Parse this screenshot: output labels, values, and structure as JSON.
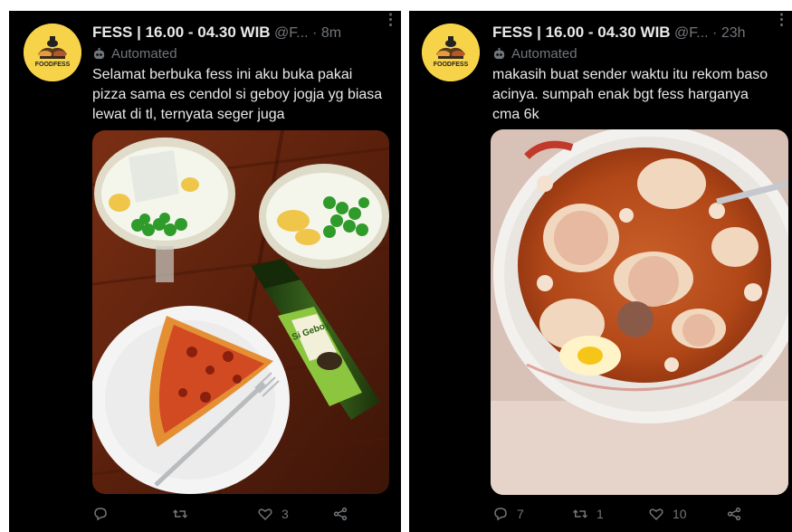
{
  "tweets": [
    {
      "display_name": "FESS | 16.00 - 04.30 WIB",
      "handle": "@F...",
      "separator": "·",
      "time": "8m",
      "more_glyph": "⋮",
      "label": "Automated",
      "avatar_text": "FOODFESS",
      "text": "Selamat berbuka fess ini aku buka pakai pizza sama es cendol si geboy jogja yg biasa lewat di tl, ternyata seger juga",
      "image_description": "Dua gelas es cendol, sepiring pizza, dan botol Si Geboy di atas meja kayu",
      "bottle_label": "Si Geboy",
      "replies": "",
      "retweets": "",
      "likes": "3"
    },
    {
      "display_name": "FESS | 16.00 - 04.30 WIB",
      "handle": "@F...",
      "separator": "·",
      "time": "23h",
      "more_glyph": "⋮",
      "label": "Automated",
      "avatar_text": "FOODFESS",
      "text": "makasih buat sender waktu itu rekom baso acinya. sumpah enak bgt fess harganya cma 6k",
      "image_description": "Semangkuk baso aci dengan kuah merah pedas",
      "replies": "7",
      "retweets": "1",
      "likes": "10"
    }
  ],
  "colors": {
    "background": "#000000",
    "text_primary": "#e7e9ea",
    "text_secondary": "#71767b",
    "avatar_yellow": "#f7d34a"
  },
  "icons": {
    "reply": "reply-icon",
    "retweet": "retweet-icon",
    "like": "heart-icon",
    "share": "share-icon",
    "automated": "bot-icon",
    "more": "more-icon"
  }
}
